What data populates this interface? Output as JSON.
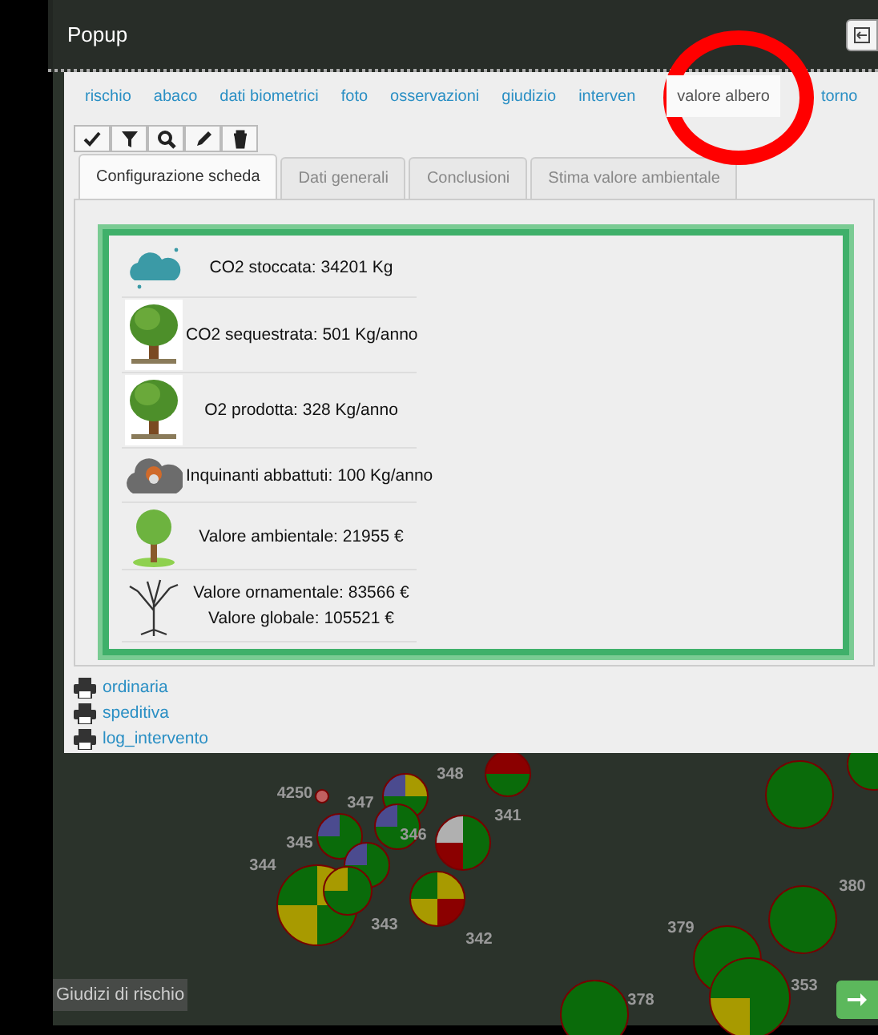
{
  "popup": {
    "title": "Popup"
  },
  "tabs": [
    {
      "label": "rischio",
      "selected": false
    },
    {
      "label": "abaco",
      "selected": false
    },
    {
      "label": "dati biometrici",
      "selected": false
    },
    {
      "label": "foto",
      "selected": false
    },
    {
      "label": "osservazioni",
      "selected": false
    },
    {
      "label": "giudizio",
      "selected": false
    },
    {
      "label": "interven",
      "selected": false
    },
    {
      "label": "valore albero",
      "selected": true
    },
    {
      "label": "torno",
      "selected": false
    }
  ],
  "toolbar": [
    {
      "kind": "check"
    },
    {
      "kind": "filter"
    },
    {
      "kind": "zoom"
    },
    {
      "kind": "edit"
    },
    {
      "kind": "delete"
    }
  ],
  "subtabs": [
    {
      "label": "Configurazione scheda",
      "selected": true
    },
    {
      "label": "Dati generali",
      "selected": false
    },
    {
      "label": "Conclusioni",
      "selected": false
    },
    {
      "label": "Stima valore ambientale",
      "selected": false
    }
  ],
  "values": [
    {
      "kind": "co2-cloud",
      "lines": [
        "CO2 stoccata: 34201 Kg"
      ]
    },
    {
      "kind": "tree",
      "lines": [
        "CO2 sequestrata: 501 Kg/anno"
      ]
    },
    {
      "kind": "tree",
      "lines": [
        "O2 prodotta: 328 Kg/anno"
      ]
    },
    {
      "kind": "smog",
      "lines": [
        "Inquinanti abbattuti: 100 Kg/anno"
      ]
    },
    {
      "kind": "small-tree",
      "lines": [
        "Valore ambientale: 21955 €"
      ]
    },
    {
      "kind": "bare-tree",
      "lines": [
        "Valore ornamentale: 83566 €",
        "Valore globale: 105521 €"
      ]
    }
  ],
  "print_links": [
    "ordinaria",
    "speditiva",
    "log_intervento"
  ],
  "map": {
    "legend": "Giudizi di rischio",
    "markers": [
      {
        "quadrants": [
          {
            "color": "#8b0000"
          },
          {
            "color": "#8b0000"
          },
          {
            "color": "#0a6b0a"
          },
          {
            "color": "#0a6b0a"
          }
        ]
      },
      {
        "label": "348",
        "quadrants": [
          {
            "color": "#4b4b8f"
          },
          {
            "color": "#a89a00"
          },
          {
            "color": "#0a6b0a"
          },
          {
            "color": "#0a6b0a"
          }
        ]
      },
      {
        "label": "347",
        "quadrants": [
          {
            "color": "#4b4b8f"
          },
          {
            "color": "#0a6b0a"
          },
          {
            "color": "#0a6b0a"
          },
          {
            "color": "#0a6b0a"
          }
        ]
      },
      {
        "label": "4250",
        "quadrants": [
          {
            "color": "#c06060"
          },
          {
            "color": "#c06060"
          },
          {
            "color": "#c06060"
          },
          {
            "color": "#c06060"
          }
        ]
      },
      {
        "label": "345",
        "quadrants": [
          {
            "color": "#4b4b8f"
          },
          {
            "color": "#0a6b0a"
          },
          {
            "color": "#0a6b0a"
          },
          {
            "color": "#0a6b0a"
          }
        ]
      },
      {
        "label": "346",
        "quadrants": [
          {
            "color": "#4b4b8f"
          },
          {
            "color": "#0a6b0a"
          },
          {
            "color": "#0a6b0a"
          },
          {
            "color": "#0a6b0a"
          }
        ]
      },
      {
        "label": "341",
        "quadrants": [
          {
            "color": "#b0b0b0"
          },
          {
            "color": "#0a6b0a"
          },
          {
            "color": "#8b0000"
          },
          {
            "color": "#0a6b0a"
          }
        ]
      },
      {
        "label": "344",
        "quadrants": [
          {
            "color": "#0a6b0a"
          },
          {
            "color": "#a89a00"
          },
          {
            "color": "#a89a00"
          },
          {
            "color": "#0a6b0a"
          }
        ]
      },
      {
        "label": "343",
        "quadrants": [
          {
            "color": "#a89a00"
          },
          {
            "color": "#0a6b0a"
          },
          {
            "color": "#0a6b0a"
          },
          {
            "color": "#0a6b0a"
          }
        ]
      },
      {
        "label": "342",
        "quadrants": [
          {
            "color": "#0a6b0a"
          },
          {
            "color": "#a89a00"
          },
          {
            "color": "#a89a00"
          },
          {
            "color": "#8b0000"
          }
        ]
      },
      {
        "quadrants": [
          {
            "color": "#0a6b0a"
          },
          {
            "color": "#0a6b0a"
          },
          {
            "color": "#0a6b0a"
          },
          {
            "color": "#0a6b0a"
          }
        ]
      },
      {
        "quadrants": [
          {
            "color": "#0a6b0a"
          },
          {
            "color": "#0a6b0a"
          },
          {
            "color": "#0a6b0a"
          },
          {
            "color": "#0a6b0a"
          }
        ]
      },
      {
        "label": "380",
        "quadrants": [
          {
            "color": "#0a6b0a"
          },
          {
            "color": "#0a6b0a"
          },
          {
            "color": "#0a6b0a"
          },
          {
            "color": "#0a6b0a"
          }
        ]
      },
      {
        "label": "379",
        "quadrants": [
          {
            "color": "#0a6b0a"
          },
          {
            "color": "#0a6b0a"
          },
          {
            "color": "#0a6b0a"
          },
          {
            "color": "#0a6b0a"
          }
        ]
      },
      {
        "label": "353",
        "quadrants": [
          {
            "color": "#0a6b0a"
          },
          {
            "color": "#0a6b0a"
          },
          {
            "color": "#a89a00"
          },
          {
            "color": "#0a6b0a"
          }
        ]
      },
      {
        "label": "378",
        "quadrants": [
          {
            "color": "#0a6b0a"
          },
          {
            "color": "#0a6b0a"
          },
          {
            "color": "#0a6b0a"
          },
          {
            "color": "#0a6b0a"
          }
        ]
      }
    ]
  }
}
